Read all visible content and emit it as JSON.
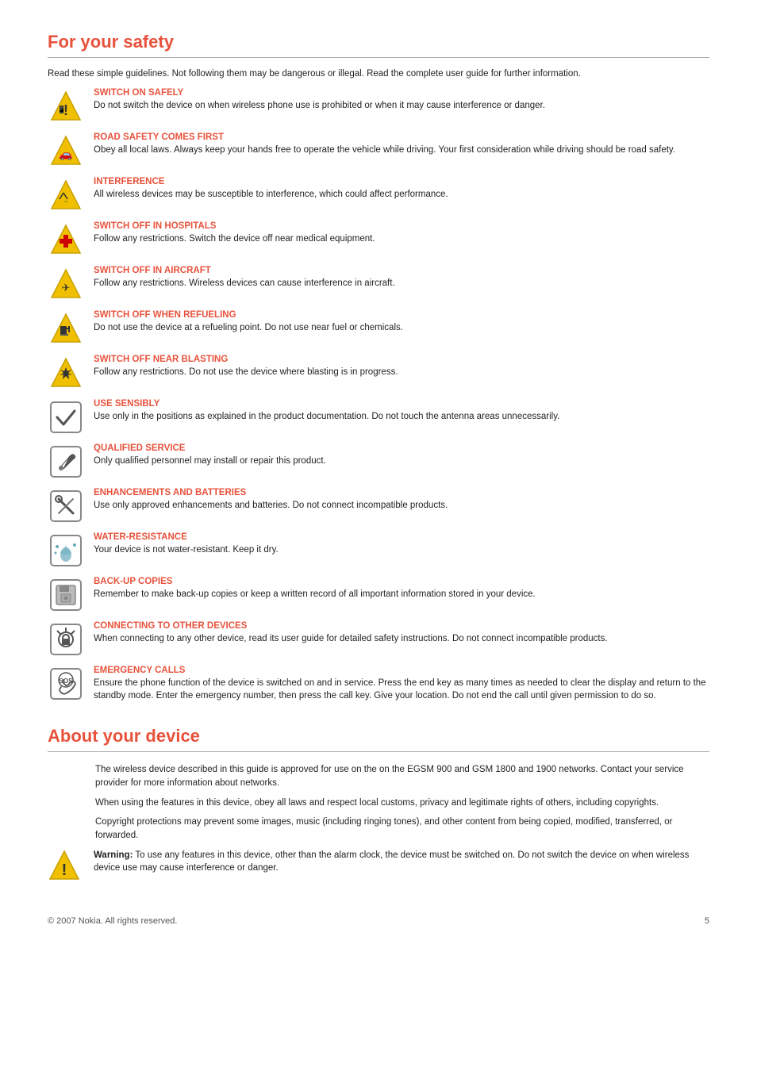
{
  "page": {
    "for_safety": {
      "title": "For your safety",
      "intro": "Read these simple guidelines. Not following them may be dangerous or illegal. Read the complete user guide for further information.",
      "items": [
        {
          "id": "switch-on-safely",
          "heading": "SWITCH ON SAFELY",
          "body": "Do not switch the device on when wireless phone use is prohibited or when it may cause interference or danger.",
          "icon": "phone-warning"
        },
        {
          "id": "road-safety",
          "heading": "ROAD SAFETY COMES FIRST",
          "body": "Obey all local laws. Always keep your hands free to operate the vehicle while driving. Your first consideration while driving should be road safety.",
          "icon": "car-warning"
        },
        {
          "id": "interference",
          "heading": "INTERFERENCE",
          "body": "All wireless devices may be susceptible to interference, which could affect performance.",
          "icon": "interference-warning"
        },
        {
          "id": "switch-off-hospitals",
          "heading": "SWITCH OFF IN HOSPITALS",
          "body": "Follow any restrictions. Switch the device off near medical equipment.",
          "icon": "hospital-warning"
        },
        {
          "id": "switch-off-aircraft",
          "heading": "SWITCH OFF IN AIRCRAFT",
          "body": "Follow any restrictions. Wireless devices can cause interference in aircraft.",
          "icon": "aircraft-warning"
        },
        {
          "id": "switch-off-refueling",
          "heading": "SWITCH OFF WHEN REFUELING",
          "body": "Do not use the device at a refueling point. Do not use near fuel or chemicals.",
          "icon": "refuel-warning"
        },
        {
          "id": "switch-off-blasting",
          "heading": "SWITCH OFF NEAR BLASTING",
          "body": "Follow any restrictions. Do not use the device where blasting is in progress.",
          "icon": "blasting-warning"
        },
        {
          "id": "use-sensibly",
          "heading": "USE SENSIBLY",
          "body": "Use only in the positions as explained in the product documentation. Do not touch the antenna areas unnecessarily.",
          "icon": "checkmark"
        },
        {
          "id": "qualified-service",
          "heading": "QUALIFIED SERVICE",
          "body": "Only qualified personnel may install or repair this product.",
          "icon": "wrench"
        },
        {
          "id": "enhancements-batteries",
          "heading": "ENHANCEMENTS AND BATTERIES",
          "body": "Use only approved enhancements and batteries. Do not connect incompatible products.",
          "icon": "wrench2"
        },
        {
          "id": "water-resistance",
          "heading": "WATER-RESISTANCE",
          "body": "Your device is not water-resistant. Keep it dry.",
          "icon": "water"
        },
        {
          "id": "back-up-copies",
          "heading": "BACK-UP COPIES",
          "body": "Remember to make back-up copies or keep a written record of all important information stored in your device.",
          "icon": "backup"
        },
        {
          "id": "connecting-devices",
          "heading": "CONNECTING TO OTHER DEVICES",
          "body": "When connecting to any other device, read its user guide for detailed safety instructions. Do not connect incompatible products.",
          "icon": "connect"
        },
        {
          "id": "emergency-calls",
          "heading": "EMERGENCY CALLS",
          "body": "Ensure the phone function of the device is switched on and in service. Press the end key as many times as needed to clear the display and return to the standby mode. Enter the emergency number, then press the call key. Give your location. Do not end the call until given permission to do so.",
          "icon": "sos"
        }
      ]
    },
    "about_device": {
      "title": "About your device",
      "paragraphs": [
        "The wireless device described in this guide is approved for use on the on the EGSM 900 and GSM 1800 and 1900 networks. Contact your service provider for more information about networks.",
        "When using the features in this device, obey all laws and respect local customs, privacy and legitimate rights of others, including copyrights.",
        "Copyright protections may prevent some images, music (including ringing tones), and other content from being copied, modified, transferred, or forwarded."
      ],
      "warning_label": "Warning:",
      "warning_body": "To use any features in this device, other than the alarm clock, the device must be switched on. Do not switch the device on when wireless device use may cause interference or danger."
    },
    "footer": {
      "copyright": "© 2007 Nokia. All rights reserved.",
      "page_number": "5"
    }
  }
}
